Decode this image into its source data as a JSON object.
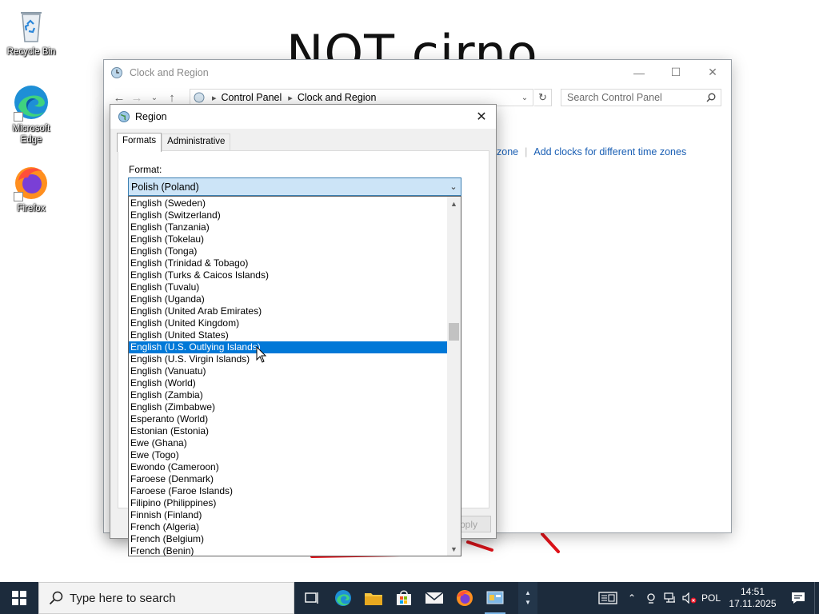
{
  "desktop": {
    "wallpaper_text": "NOT cirno",
    "icons": [
      {
        "label": "Recycle Bin",
        "icon": "recycle-bin-icon"
      },
      {
        "label": "Microsoft Edge",
        "icon": "edge-icon"
      },
      {
        "label": "Firefox",
        "icon": "firefox-icon"
      }
    ]
  },
  "control_panel_window": {
    "title": "Clock and Region",
    "breadcrumb": [
      "Control Panel",
      "Clock and Region"
    ],
    "search_placeholder": "Search Control Panel",
    "link_partial": "zone",
    "link_add_clocks": "Add clocks for different time zones"
  },
  "region_dialog": {
    "title": "Region",
    "tabs": [
      "Formats",
      "Administrative"
    ],
    "active_tab": "Formats",
    "format_label": "Format:",
    "selected_format": "Polish (Poland)",
    "apply_label": "Apply",
    "dropdown_items": [
      "English (Sweden)",
      "English (Switzerland)",
      "English (Tanzania)",
      "English (Tokelau)",
      "English (Tonga)",
      "English (Trinidad & Tobago)",
      "English (Turks & Caicos Islands)",
      "English (Tuvalu)",
      "English (Uganda)",
      "English (United Arab Emirates)",
      "English (United Kingdom)",
      "English (United States)",
      "English (U.S. Outlying Islands)",
      "English (U.S. Virgin Islands)",
      "English (Vanuatu)",
      "English (World)",
      "English (Zambia)",
      "English (Zimbabwe)",
      "Esperanto (World)",
      "Estonian (Estonia)",
      "Ewe (Ghana)",
      "Ewe (Togo)",
      "Ewondo (Cameroon)",
      "Faroese (Denmark)",
      "Faroese (Faroe Islands)",
      "Filipino (Philippines)",
      "Finnish (Finland)",
      "French (Algeria)",
      "French (Belgium)",
      "French (Benin)"
    ],
    "highlighted_item": "English (U.S. Outlying Islands)"
  },
  "taskbar": {
    "search_placeholder": "Type here to search",
    "pinned": [
      "task-view-icon",
      "edge-icon",
      "file-explorer-icon",
      "store-icon",
      "mail-icon",
      "firefox-icon",
      "control-panel-icon"
    ],
    "language": "POL",
    "time": "14:51",
    "date": "17.11.2025"
  },
  "colors": {
    "selection": "#0078d7",
    "link": "#1a5fb4",
    "taskbar": "#1c2b3c",
    "combo_focus": "#cce4f7"
  }
}
